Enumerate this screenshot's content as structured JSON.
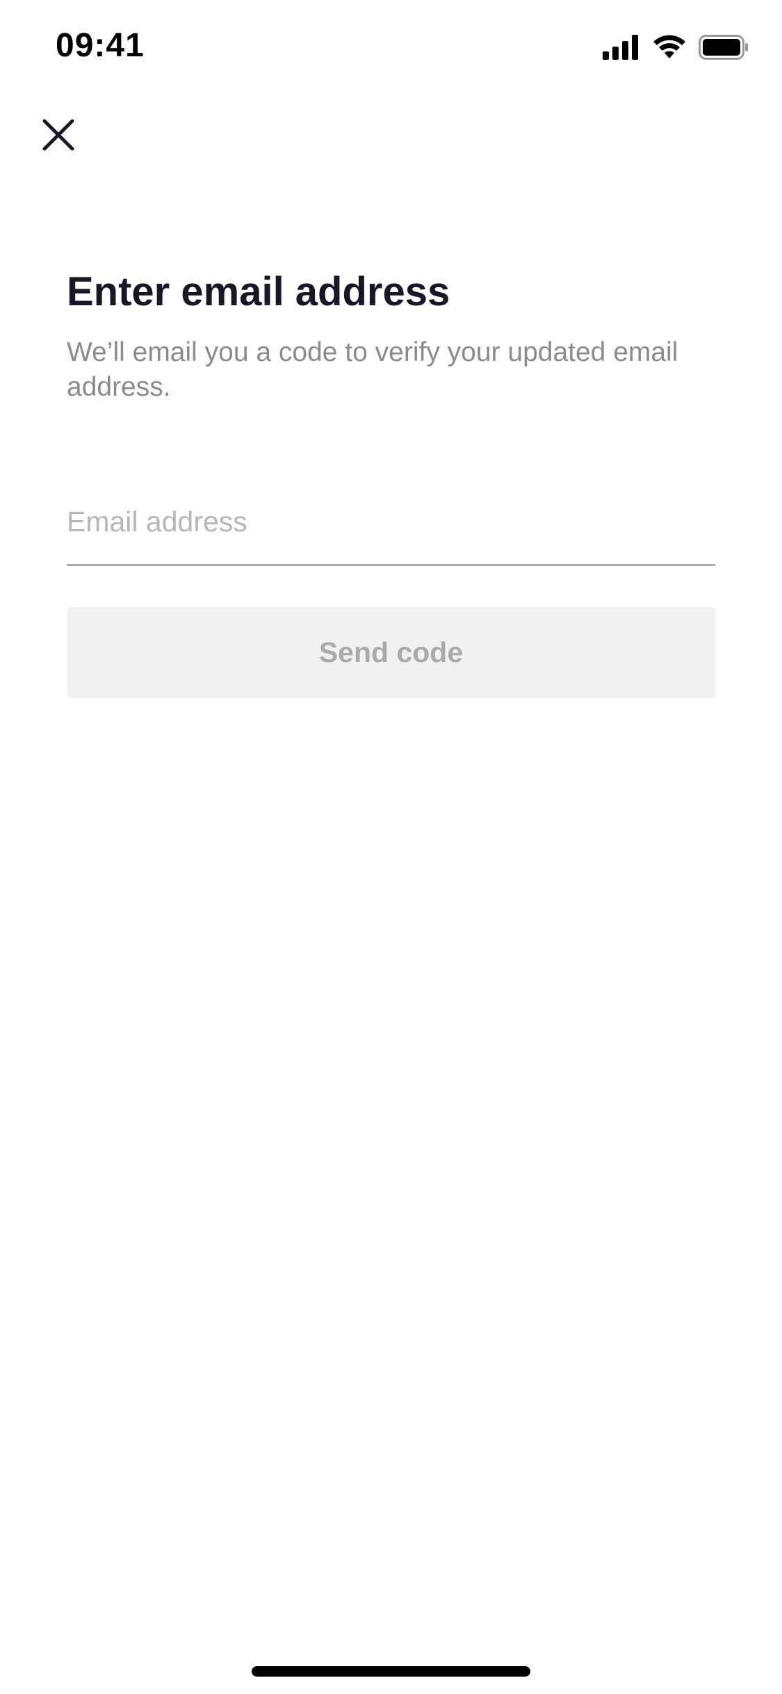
{
  "status_bar": {
    "time": "09:41",
    "icons": [
      "cellular-signal-icon",
      "wifi-icon",
      "battery-icon"
    ]
  },
  "header": {
    "close_icon": "close-icon"
  },
  "main": {
    "title": "Enter email address",
    "subtitle": "We’ll email you a code to verify your updated email address.",
    "email_field": {
      "value": "",
      "placeholder": "Email address"
    },
    "send_button": {
      "label": "Send code",
      "state": "disabled"
    }
  },
  "colors": {
    "title_text": "#161823",
    "subtitle_text": "#8a8b91",
    "placeholder_text": "#b5b6ba",
    "input_underline": "#a7a8ac",
    "button_bg_disabled": "#f1f1f2",
    "button_text_disabled": "#a9aaae",
    "home_indicator": "#000000"
  }
}
